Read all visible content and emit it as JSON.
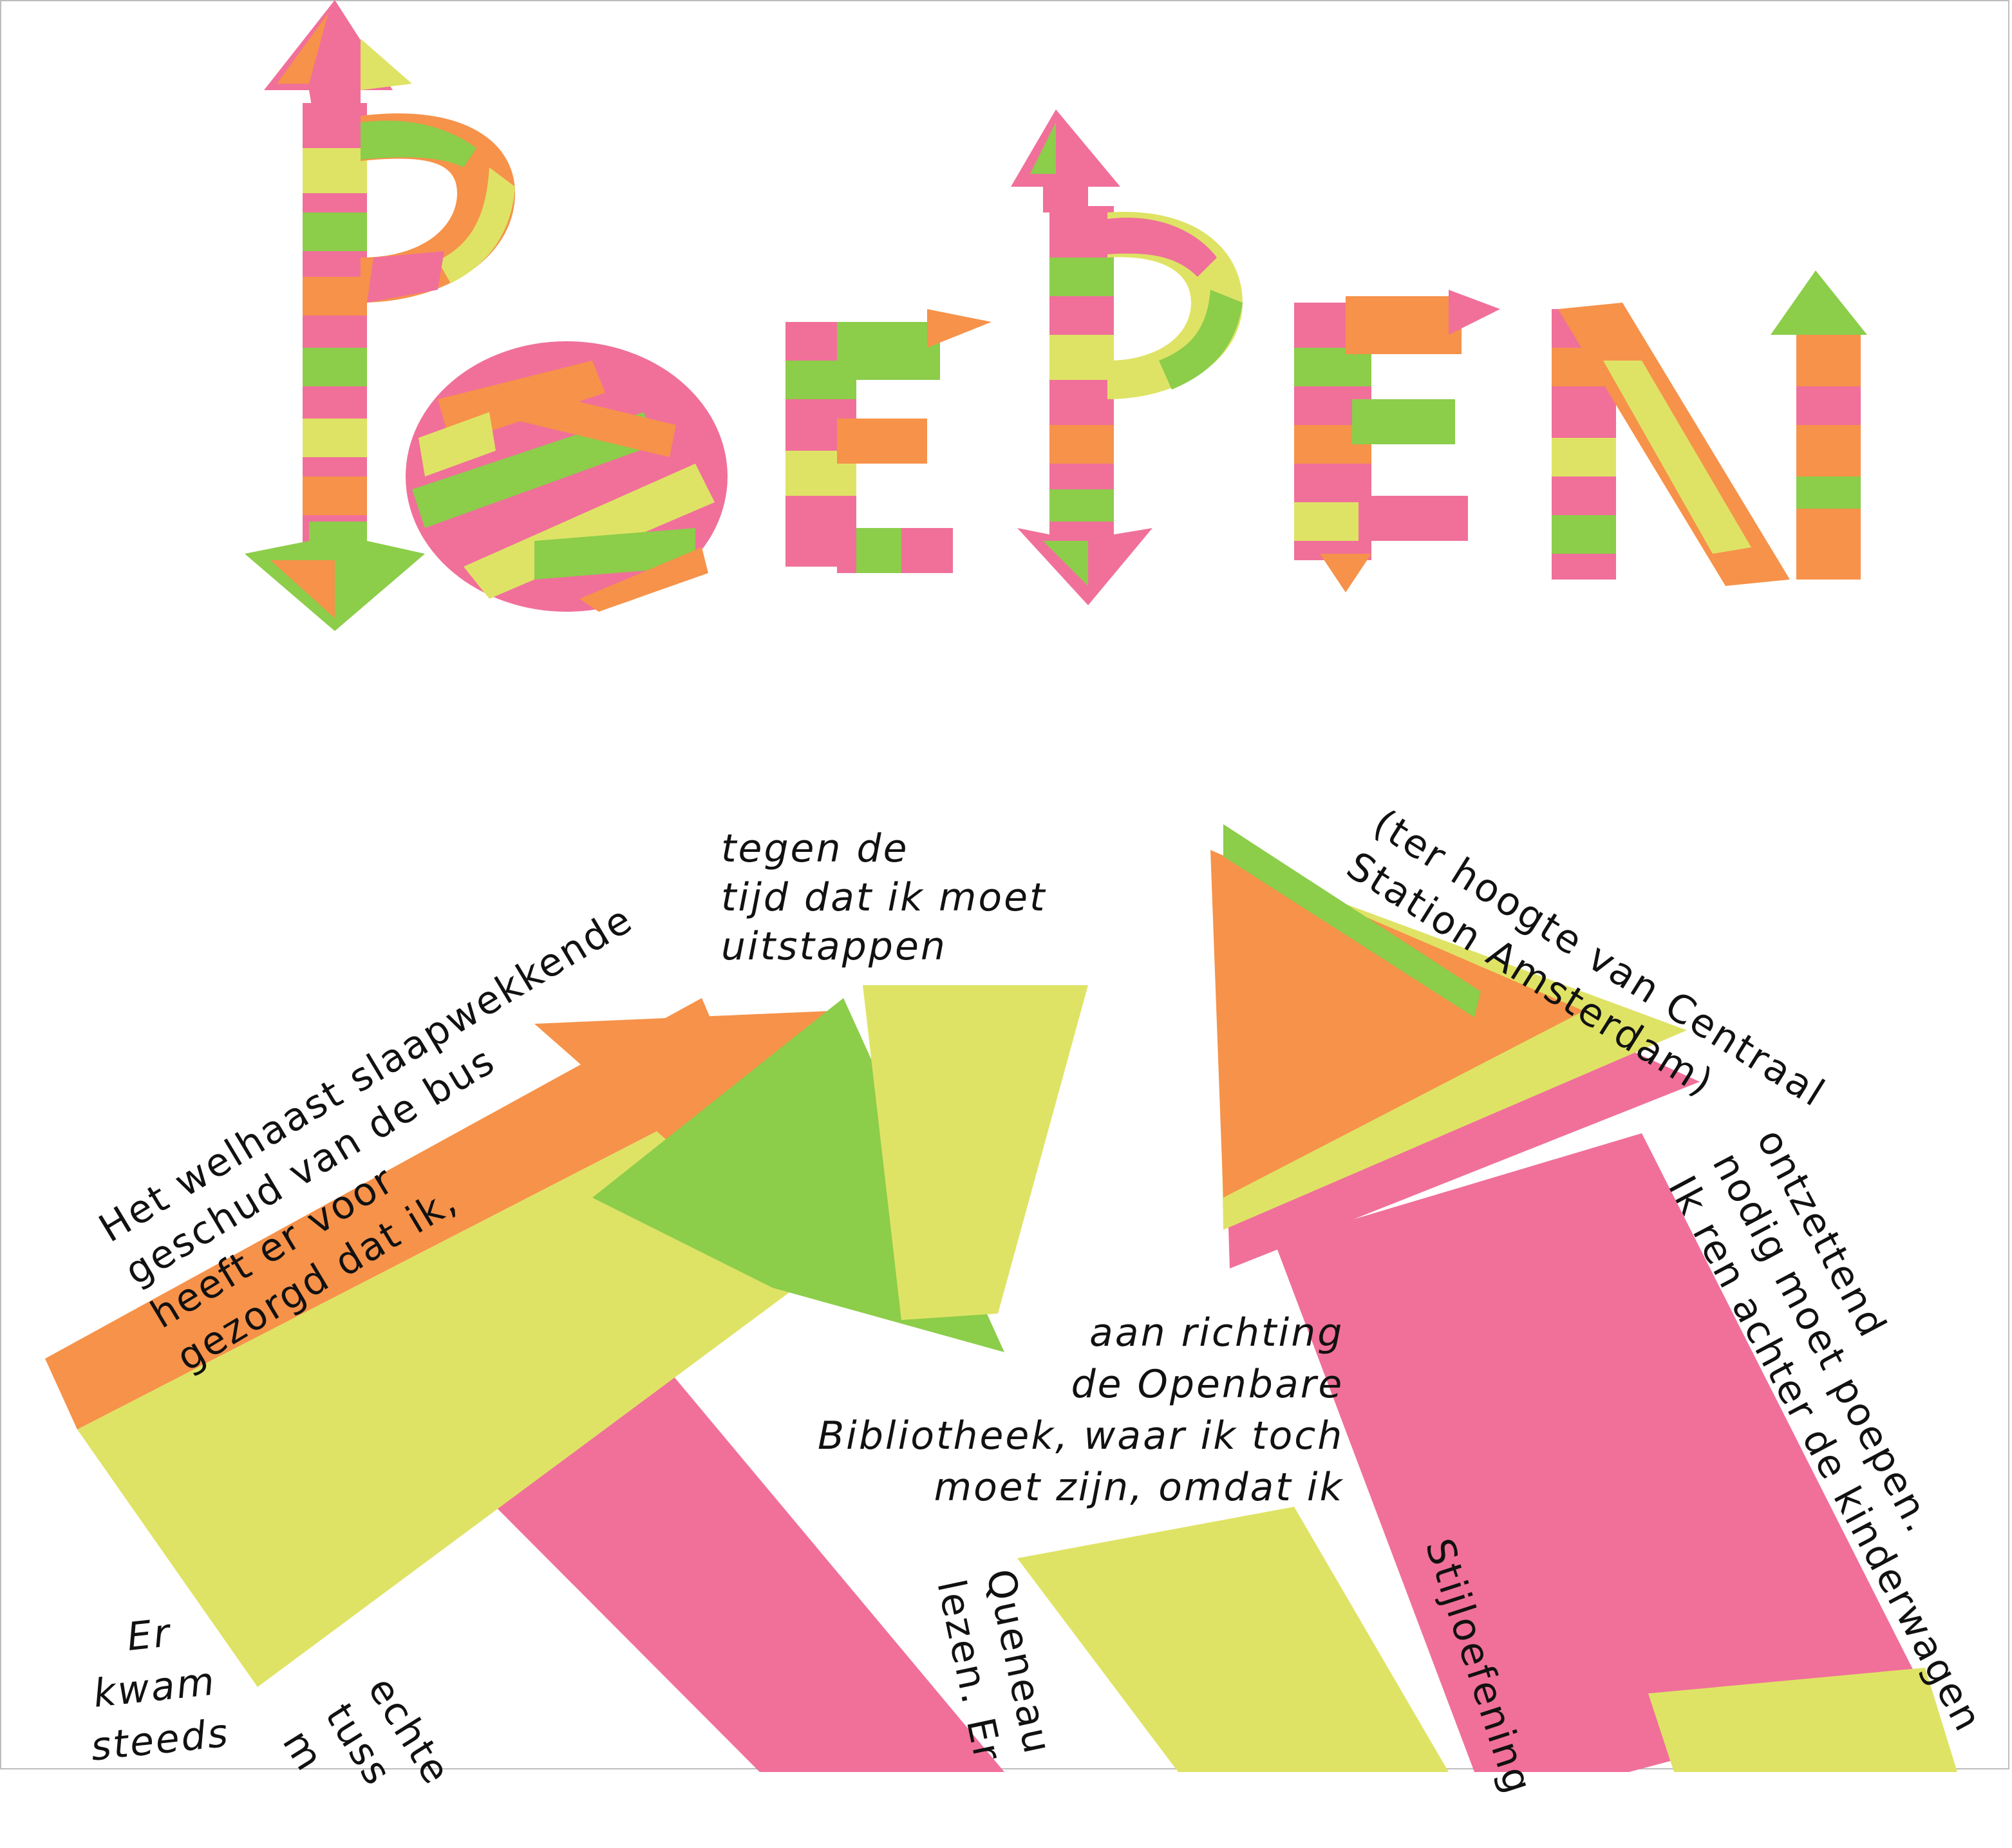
{
  "title": "POEPEN",
  "colors": {
    "pink": "#f0709a",
    "orange": "#f6924a",
    "green": "#8ccd4a",
    "yellow": "#dfe365",
    "text": "#111111"
  },
  "captions": {
    "welhaast": "Het welhaast slaapwekkende\ngeschud van de bus\nheeft er voor\ngezorgd dat ik,",
    "tegen": "tegen de\ntijd dat ik moet\nuitstappen",
    "ter_hoogte": "(ter hoogte van Centraal\nStation Amsterdam)",
    "ontzettend": "ontzettend\nnodig moet poepen.\nIk ren achter de kinderwagen",
    "aan_richting": "aan richting\nde Openbare\nBibliotheek, waar ik toch\nmoet zijn, omdat ik",
    "er_kwam": "Er\nkwam\nsteeds",
    "echter": "echte\ntuss\nm",
    "queneau": "Queneau\nlezen. Er",
    "stijl": "Stijloefening"
  }
}
